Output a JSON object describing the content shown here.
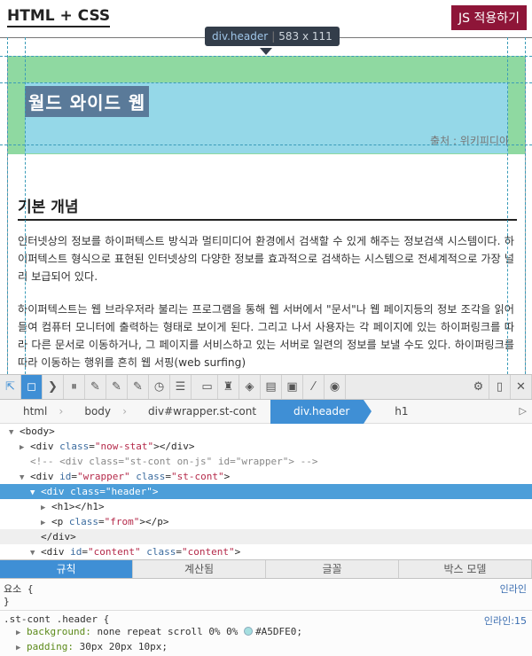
{
  "page": {
    "title": "HTML + CSS",
    "js_button": "JS 적용하기",
    "tooltip_tag": "div.header",
    "tooltip_size": "583 x 111",
    "h1": "월드 와이드 웹",
    "from": "출처 : 위키피디아",
    "h2": "기본 개념",
    "p1": "인터넷상의 정보를 하이퍼텍스트 방식과 멀티미디어 환경에서 검색할 수 있게 해주는 정보검색 시스템이다. 하이퍼텍스트 형식으로 표현된 인터넷상의 다양한 정보를 효과적으로 검색하는 시스템으로 전세계적으로 가장 널리 보급되어 있다.",
    "p2": "하이퍼텍스트는 웹 브라우저라 불리는 프로그램을 통해 웹 서버에서 \"문서\"나 웹 페이지등의 정보 조각을 읽어들여 컴퓨터 모니터에 출력하는 형태로 보이게 된다. 그리고 나서 사용자는 각 페이지에 있는 하이퍼링크를 따라 다른 문서로 이동하거나, 그 페이지를 서비스하고 있는 서버로 일련의 정보를 보낼 수도 있다. 하이퍼링크를 따라 이동하는 행위를 흔히 웹 서핑(web surfing)"
  },
  "devtools": {
    "toolbar_icons": [
      "element-picker-icon",
      "box-highlight-icon",
      "console-icon",
      "debugger-icon",
      "style-editor-icon",
      "shader-editor-icon",
      "canvas-icon",
      "performance-icon",
      "network-icon",
      "storage-icon",
      "scratchpad-icon",
      "responsive-icon",
      "layout-icon",
      "paint-flashing-icon",
      "screenshot-icon",
      "eyedropper-icon",
      "camera-icon",
      "settings-icon",
      "dock-icon",
      "close-icon"
    ],
    "breadcrumbs": [
      "html",
      "body",
      "div#wrapper.st-cont",
      "div.header",
      "h1"
    ],
    "active_crumb": "div.header",
    "dom": {
      "body": "<body>",
      "now_stat_tag": "div",
      "now_stat_attr": "class",
      "now_stat_val": "\"now-stat\"",
      "now_stat_close": "></div>",
      "comment": "<!-- <div class=\"st-cont on-js\" id=\"wrapper\"> -->",
      "wrapper_tag": "div",
      "wrapper_id_attr": "id",
      "wrapper_id_val": "\"wrapper\"",
      "wrapper_class_attr": "class",
      "wrapper_class_val": "\"st-cont\"",
      "header_tag": "div",
      "header_attr": "class",
      "header_val": "\"header\"",
      "h1_row": "<h1></h1>",
      "p_tag": "p",
      "p_attr": "class",
      "p_val": "\"from\"",
      "p_close": "></p>",
      "div_close": "</div>",
      "content_tag": "div",
      "content_id_attr": "id",
      "content_id_val": "\"content\"",
      "content_class_attr": "class",
      "content_class_val": "\"content\""
    },
    "rule_tabs": [
      "규칙",
      "계산됨",
      "글꼴",
      "박스 모델"
    ],
    "active_rule_tab": "규칙",
    "rules": {
      "element_selector": "요소 {",
      "element_close": "}",
      "element_src": "인라인",
      "rule1_selector": ".st-cont .header {",
      "rule1_src": "인라인:15",
      "bg_prop": "background:",
      "bg_val": "none repeat scroll 0% 0%",
      "bg_color": "#A5DFE0;",
      "pad_prop": "padding:",
      "pad_val": "30px 20px 10px;"
    }
  }
}
